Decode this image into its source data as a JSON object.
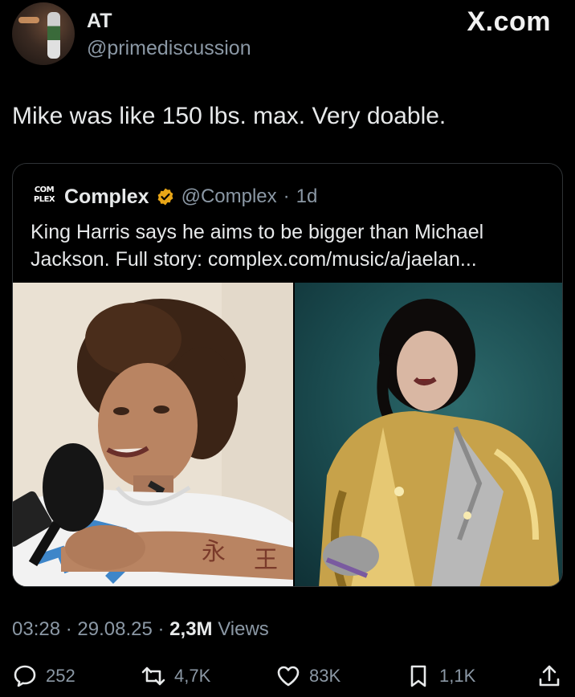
{
  "author": {
    "name": "AT",
    "handle": "@primediscussion"
  },
  "site_label": "X.com",
  "tweet_text": "Mike was like 150 lbs. max. Very doable.",
  "quoted": {
    "logo_text": "COM PLEX",
    "name": "Complex",
    "handle": "@Complex",
    "separator": "·",
    "age": "1d",
    "text": "King Harris says he aims to be bigger than Michael Jackson. Full story: complex.com/music/a/jaelan..."
  },
  "meta": {
    "time": "03:28",
    "date": "29.08.25",
    "views_count": "2,3M",
    "views_label": "Views",
    "sep": "·"
  },
  "actions": {
    "replies": "252",
    "reposts": "4,7K",
    "likes": "83K",
    "bookmarks": "1,1K"
  },
  "colors": {
    "background": "#000000",
    "text": "#e7e9ea",
    "secondary": "#8b98a5",
    "verified": "#e8a617",
    "border": "#2f3336"
  }
}
